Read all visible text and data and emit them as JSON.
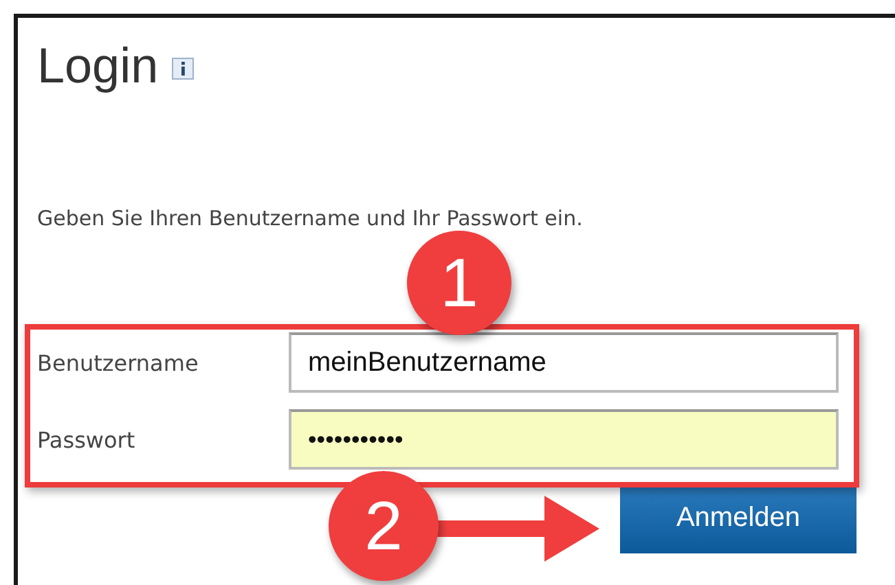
{
  "panel": {
    "title": "Login",
    "instruction": "Geben Sie Ihren Benutzername und Ihr Passwort ein."
  },
  "fields": [
    {
      "label": "Benutzername",
      "value": "meinBenutzername",
      "kind": "text",
      "highlighted": false
    },
    {
      "label": "Passwort",
      "value": "•••••••••••",
      "kind": "password",
      "highlighted": true
    }
  ],
  "submit_button": {
    "label": "Anmelden"
  },
  "annotations": [
    {
      "number": "1"
    },
    {
      "number": "2"
    }
  ]
}
